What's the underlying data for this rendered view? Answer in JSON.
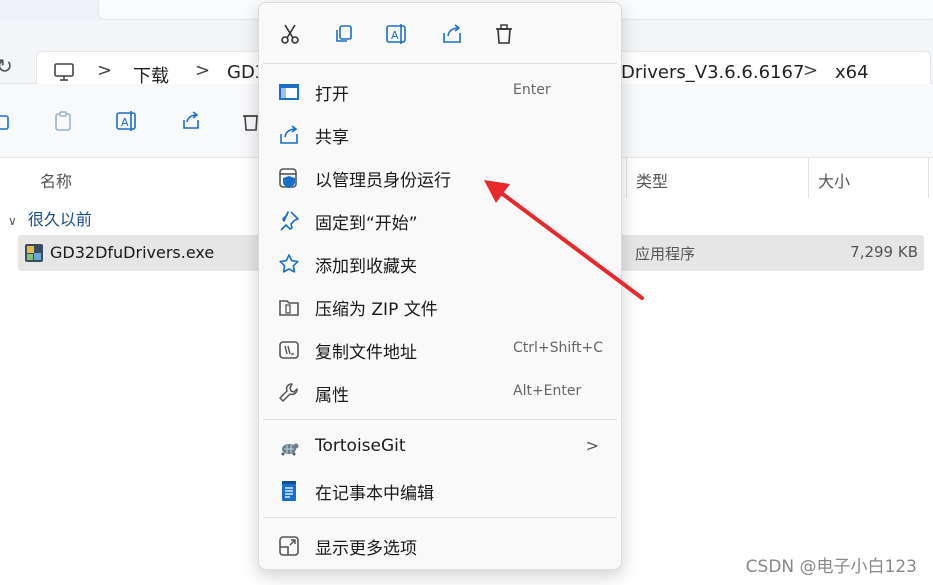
{
  "breadcrumb": {
    "items": [
      "下载",
      "GD3",
      "Drivers_V3.6.6.6167",
      "x64"
    ],
    "separators": [
      ">",
      ">",
      ">"
    ]
  },
  "columns": {
    "name": "名称",
    "type": "类型",
    "size": "大小"
  },
  "group_label": "很久以前",
  "file": {
    "name": "GD32DfuDrivers.exe",
    "type": "应用程序",
    "size": "7,299 KB"
  },
  "context_menu": {
    "top_icons": [
      "cut-icon",
      "copy-icon",
      "rename-icon",
      "share-icon",
      "delete-icon"
    ],
    "items": [
      {
        "label": "打开",
        "shortcut": "Enter",
        "icon": "open-icon"
      },
      {
        "label": "共享",
        "shortcut": "",
        "icon": "share-icon"
      },
      {
        "label": "以管理员身份运行",
        "shortcut": "",
        "icon": "run-as-admin-icon"
      },
      {
        "label": "固定到“开始”",
        "shortcut": "",
        "icon": "pin-icon"
      },
      {
        "label": "添加到收藏夹",
        "shortcut": "",
        "icon": "star-icon"
      },
      {
        "label": "压缩为 ZIP 文件",
        "shortcut": "",
        "icon": "zip-icon"
      },
      {
        "label": "复制文件地址",
        "shortcut": "Ctrl+Shift+C",
        "icon": "copy-path-icon"
      },
      {
        "label": "属性",
        "shortcut": "Alt+Enter",
        "icon": "wrench-icon"
      },
      {
        "label": "TortoiseGit",
        "shortcut": "",
        "icon": "tortoisegit-icon",
        "submenu_arrow": ">"
      },
      {
        "label": "在记事本中编辑",
        "shortcut": "",
        "icon": "notepad-icon"
      },
      {
        "label": "显示更多选项",
        "shortcut": "",
        "icon": "more-options-icon"
      }
    ]
  },
  "watermark": "CSDN @电子小白123",
  "colors": {
    "accent": "#1a6fc8",
    "annotation_arrow": "#e8282b",
    "selected_row": "#e6e6e6"
  }
}
